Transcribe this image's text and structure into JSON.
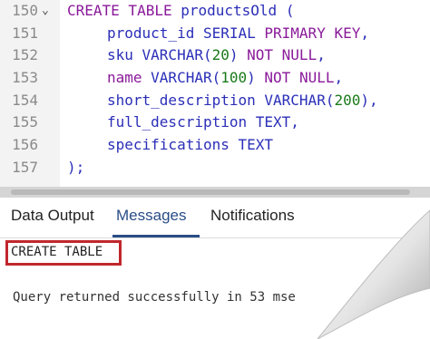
{
  "editor": {
    "lines": [
      {
        "number": "150",
        "parts": [
          [
            "CREATE TABLE",
            "kw"
          ],
          [
            " productsOld (",
            "id"
          ]
        ],
        "fold": "⌄"
      },
      {
        "number": "151",
        "parts": [
          [
            "product_id SERIAL ",
            "id"
          ],
          [
            "PRIMARY KEY",
            "kw"
          ],
          [
            ",",
            "id"
          ]
        ]
      },
      {
        "number": "152",
        "parts": [
          [
            "sku VARCHAR(",
            "id"
          ],
          [
            "20",
            "num"
          ],
          [
            ") ",
            "id"
          ],
          [
            "NOT NULL",
            "kw"
          ],
          [
            ",",
            "id"
          ]
        ]
      },
      {
        "number": "153",
        "parts": [
          [
            "name",
            "kw"
          ],
          [
            " VARCHAR(",
            "id"
          ],
          [
            "100",
            "num"
          ],
          [
            ") ",
            "id"
          ],
          [
            "NOT NULL",
            "kw"
          ],
          [
            ",",
            "id"
          ]
        ]
      },
      {
        "number": "154",
        "parts": [
          [
            "short_description VARCHAR(",
            "id"
          ],
          [
            "200",
            "num"
          ],
          [
            "),",
            "id"
          ]
        ]
      },
      {
        "number": "155",
        "parts": [
          [
            "full_description TEXT,",
            "id"
          ]
        ]
      },
      {
        "number": "156",
        "parts": [
          [
            "specifications TEXT",
            "id"
          ]
        ]
      },
      {
        "number": "157",
        "parts": [
          [
            ");",
            "id"
          ]
        ]
      }
    ]
  },
  "tabs": {
    "data_output": "Data Output",
    "messages": "Messages",
    "notifications": "Notifications"
  },
  "messages": {
    "result": "CREATE TABLE",
    "query_status": "Query returned successfully in 53 mse"
  },
  "colors": {
    "keyword": "#8a1a9a",
    "identifier": "#2b2fb7",
    "number": "#1a7a1a",
    "highlight_box": "#c0272d",
    "active_tab": "#2a4e86"
  }
}
